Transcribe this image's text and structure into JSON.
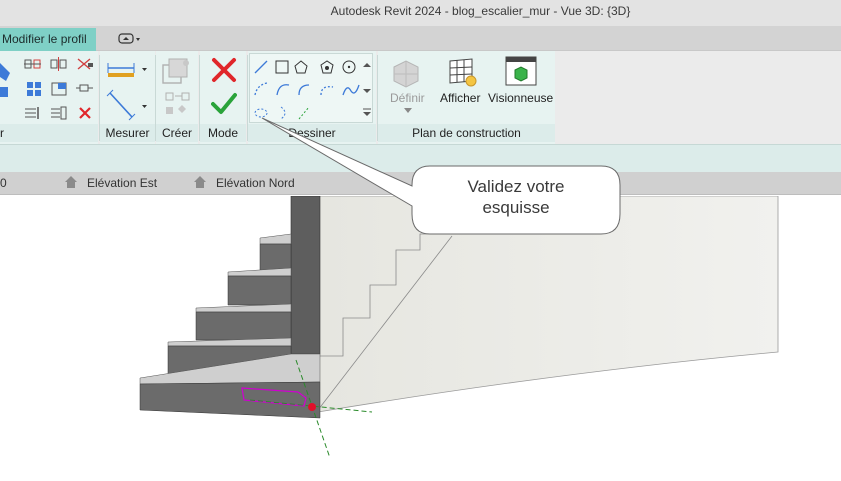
{
  "window": {
    "title": "Autodesk Revit 2024 - blog_escalier_mur - Vue 3D: {3D}"
  },
  "tabs": {
    "active_label": "Modifier le profil"
  },
  "ribbon": {
    "panels": {
      "measure": "Mesurer",
      "create": "Créer",
      "mode": "Mode",
      "draw": "Dessiner",
      "work_plane": "Plan de construction"
    },
    "work_plane_buttons": {
      "define": "Définir",
      "show": "Afficher",
      "viewer": "Visionneuse"
    }
  },
  "view_tabs": {
    "partial": "0",
    "items": [
      "Elévation Est",
      "Elévation Nord"
    ]
  },
  "callout": {
    "line1": "Validez votre",
    "line2": "esquisse"
  },
  "colors": {
    "accent_tab": "#7fd0c6",
    "cancel_red": "#e0262a",
    "finish_green": "#2aa33a",
    "sketch_magenta": "#d000d0"
  }
}
